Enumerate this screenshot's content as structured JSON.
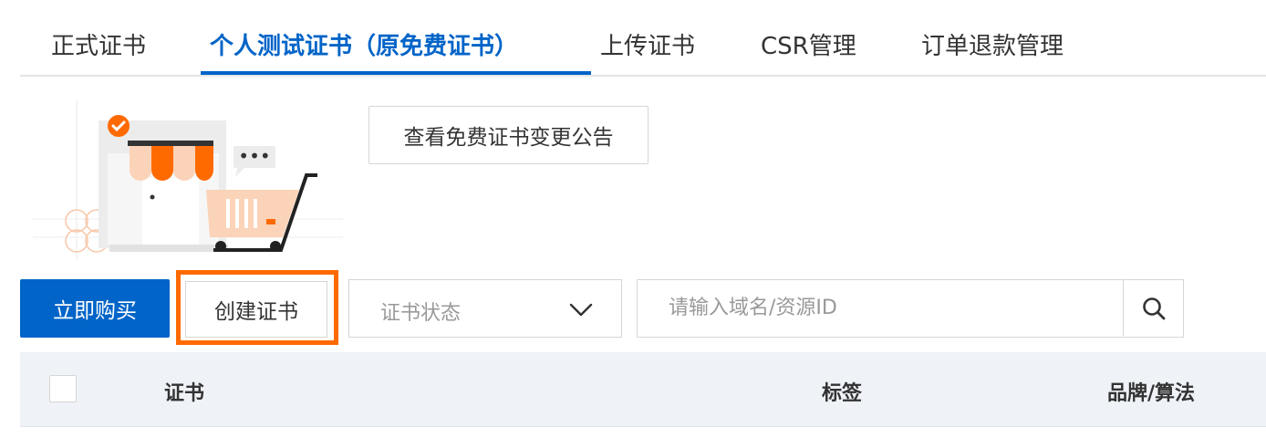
{
  "tabs": [
    {
      "label": "正式证书",
      "active": false
    },
    {
      "label": "个人测试证书（原免费证书）",
      "active": true
    },
    {
      "label": "上传证书",
      "active": false
    },
    {
      "label": "CSR管理",
      "active": false
    },
    {
      "label": "订单退款管理",
      "active": false
    }
  ],
  "illustration": {
    "icon": "shop-cart-illustration",
    "bubble_text": "•••"
  },
  "notice_button": "查看免费证书变更公告",
  "toolbar": {
    "buy_label": "立即购买",
    "create_label": "创建证书",
    "status_placeholder": "证书状态",
    "search_placeholder": "请输入域名/资源ID"
  },
  "table": {
    "columns": [
      "证书",
      "标签",
      "品牌/算法"
    ]
  },
  "colors": {
    "primary": "#0064c8",
    "highlight": "#ff6a00",
    "header_bg": "#eff2f7"
  }
}
